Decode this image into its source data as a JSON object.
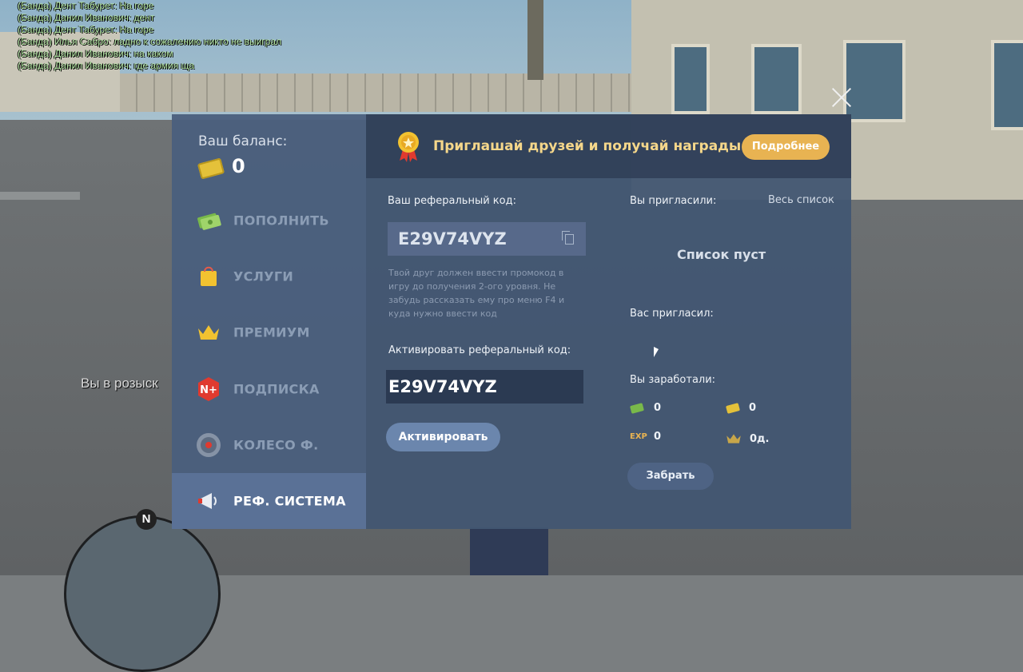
{
  "chat_lines": [
    "(Банда) Дент Табурет: На горе",
    "(Банда) Данил Иванович: дент",
    "(Банда) Дент Табурет: На горе",
    "(Банда) Илья Сабро: ладно к сожалению никто не выиграл",
    "(Банда) Данил Иванович: на каком",
    "(Банда) Данил Иванович: где армия ща"
  ],
  "hud": {
    "wanted_text": "Вы в розыск",
    "minimap_north": "N"
  },
  "sidebar": {
    "balance_label": "Ваш баланс:",
    "balance_value": "0",
    "items": [
      {
        "label": "ПОПОЛНИТЬ",
        "icon": "money-icon"
      },
      {
        "label": "УСЛУГИ",
        "icon": "shopping-bag-icon"
      },
      {
        "label": "ПРЕМИУМ",
        "icon": "crown-icon"
      },
      {
        "label": "ПОДПИСКА",
        "icon": "subscription-icon"
      },
      {
        "label": "КОЛЕСО Ф.",
        "icon": "fortune-wheel-icon"
      },
      {
        "label": "РЕФ. СИСТЕМА",
        "icon": "megaphone-icon"
      }
    ]
  },
  "banner": {
    "text": "Приглашай друзей и получай награды",
    "more_button": "Подробнее"
  },
  "referral": {
    "your_code_label": "Ваш реферальный код:",
    "your_code": "E29V74VYZ",
    "hint": "Твой друг должен ввести промокод в игру до получения 2-ого уровня. Не забудь рассказать ему про меню F4 и куда нужно ввести код",
    "activate_label": "Активировать реферальный код:",
    "activate_input_value": "E29V74VYZ",
    "activate_button": "Активировать"
  },
  "invites": {
    "invited_label": "Вы пригласили:",
    "full_list": "Весь список",
    "empty_text": "Список пуст",
    "invited_by_label": "Вас пригласил:",
    "earned_label": "Вы заработали:",
    "earned_money": "0",
    "earned_donate": "0",
    "exp_label": "EXP",
    "earned_exp": "0",
    "earned_premium": "0д.",
    "take_button": "Забрать"
  },
  "colors": {
    "accent": "#e8b352",
    "sidebar_bg": "#4a5f7d",
    "active_item": "#5a7196",
    "banner_text": "#f5d78a"
  }
}
